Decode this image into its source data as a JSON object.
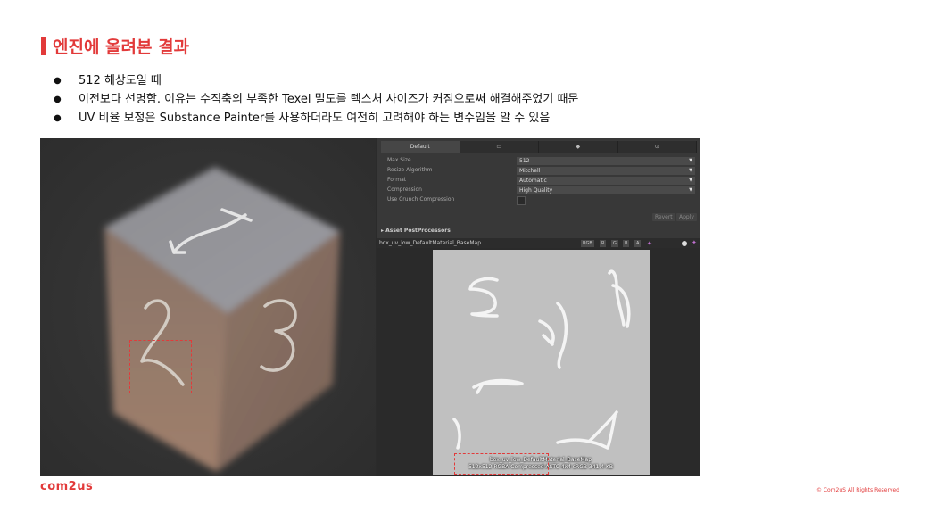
{
  "slide": {
    "title": "엔진에 올려본 결과",
    "bullets": [
      "512 해상도일 때",
      "이전보다 선명함. 이유는 수직축의 부족한 Texel 밀도를 텍스처 사이즈가 커짐으로써 해결해주었기 때문",
      "UV 비율 보정은 Substance Painter를 사용하더라도 여전히 고려해야 하는 변수임을 알 수 있음"
    ],
    "logo": "com2us",
    "copyright": "© Com2uS All Rights Reserved"
  },
  "inspector": {
    "tabs": [
      "Default",
      "monitor-icon",
      "android-icon",
      "other-platform-icon"
    ],
    "tab_default_label": "Default",
    "properties": [
      {
        "label": "Max Size",
        "value": "512"
      },
      {
        "label": "Resize Algorithm",
        "value": "Mitchell"
      },
      {
        "label": "Format",
        "value": "Automatic"
      },
      {
        "label": "Compression",
        "value": "High Quality"
      }
    ],
    "crunch_label": "Use Crunch Compression",
    "revert_label": "Revert",
    "apply_label": "Apply",
    "foldout_label": "Asset PostProcessors",
    "preview": {
      "title": "box_uv_low_DefaultMaterial_BaseMap",
      "channels": [
        "RGB",
        "R",
        "G",
        "B",
        "A"
      ],
      "caption_line1": "box_uv_low_DefaultMaterial_BaseMap",
      "caption_line2": "512x512  RGBA Compressed ASTC 4x4 sRGB  341.4 KB"
    }
  },
  "colors": {
    "accent": "#e23a3a",
    "editor_bg": "#383838",
    "texture_bg": "#c0c0c0"
  }
}
